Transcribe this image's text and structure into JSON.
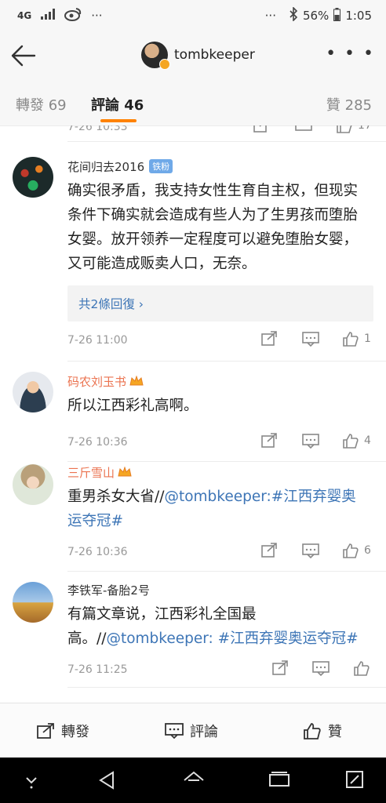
{
  "status_bar": {
    "network": "4G",
    "battery": "56%",
    "time": "1:05",
    "extra": "···"
  },
  "header": {
    "username": "tombkeeper",
    "more": "• • •"
  },
  "tabs": {
    "repost": "轉發 69",
    "comment": "評論 46",
    "like": "贊 285"
  },
  "partial_top": {
    "time": "7-26 10:33",
    "likes": "17"
  },
  "comments": [
    {
      "user": "花间归去2016",
      "badge": "铁粉",
      "text": "确实很矛盾，我支持女性生育自主权，但现实条件下确实就会造成有些人为了生男孩而堕胎女婴。放开领养一定程度可以避免堕胎女婴，又可能造成贩卖人口，无奈。",
      "replies": "共2條回復 ›",
      "time": "7-26 11:00",
      "likes": "1"
    },
    {
      "user": "码农刘玉书",
      "text": "所以江西彩礼高啊。",
      "time": "7-26 10:36",
      "likes": "4"
    },
    {
      "user": "三斤雪山",
      "text_prefix": "重男杀女大省//",
      "mention": "@tombkeeper",
      "text_mid": ":",
      "hashtag": "#江西弃婴奥运夺冠#",
      "time": "7-26 10:36",
      "likes": "6"
    },
    {
      "user": "李铁军-备胎2号",
      "text_prefix": "有篇文章说，江西彩礼全国最高。//",
      "mention": "@tombkeeper",
      "text_mid": ": ",
      "hashtag": "#江西弃婴奥运夺冠#",
      "time": "7-26 11:25",
      "likes": ""
    }
  ],
  "bottom_bar": {
    "repost": "轉發",
    "comment": "評論",
    "like": "贊"
  },
  "colors": {
    "accent": "#ff8200",
    "link": "#3d75b6",
    "orange_name": "#eb7350"
  }
}
